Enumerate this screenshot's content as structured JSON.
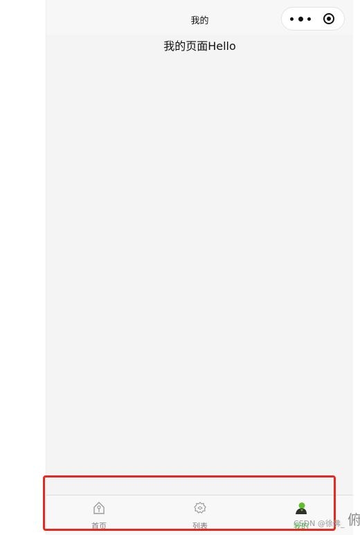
{
  "navbar": {
    "title": "我的",
    "menu_icon": "more-dots-icon",
    "close_icon": "target-circle-icon"
  },
  "page": {
    "text": "我的页面Hello"
  },
  "tabbar": {
    "items": [
      {
        "label": "首页",
        "icon": "home-icon",
        "active": false
      },
      {
        "label": "列表",
        "icon": "list-icon",
        "active": false
      },
      {
        "label": "我的",
        "icon": "user-icon",
        "active": true
      }
    ],
    "active_color": "#3cb43c",
    "inactive_color": "#7a7a7a"
  },
  "annotation": {
    "color": "#e8281f"
  },
  "watermark": {
    "text": "CSDN @徐佛_",
    "trailing_glyph": "俯"
  }
}
